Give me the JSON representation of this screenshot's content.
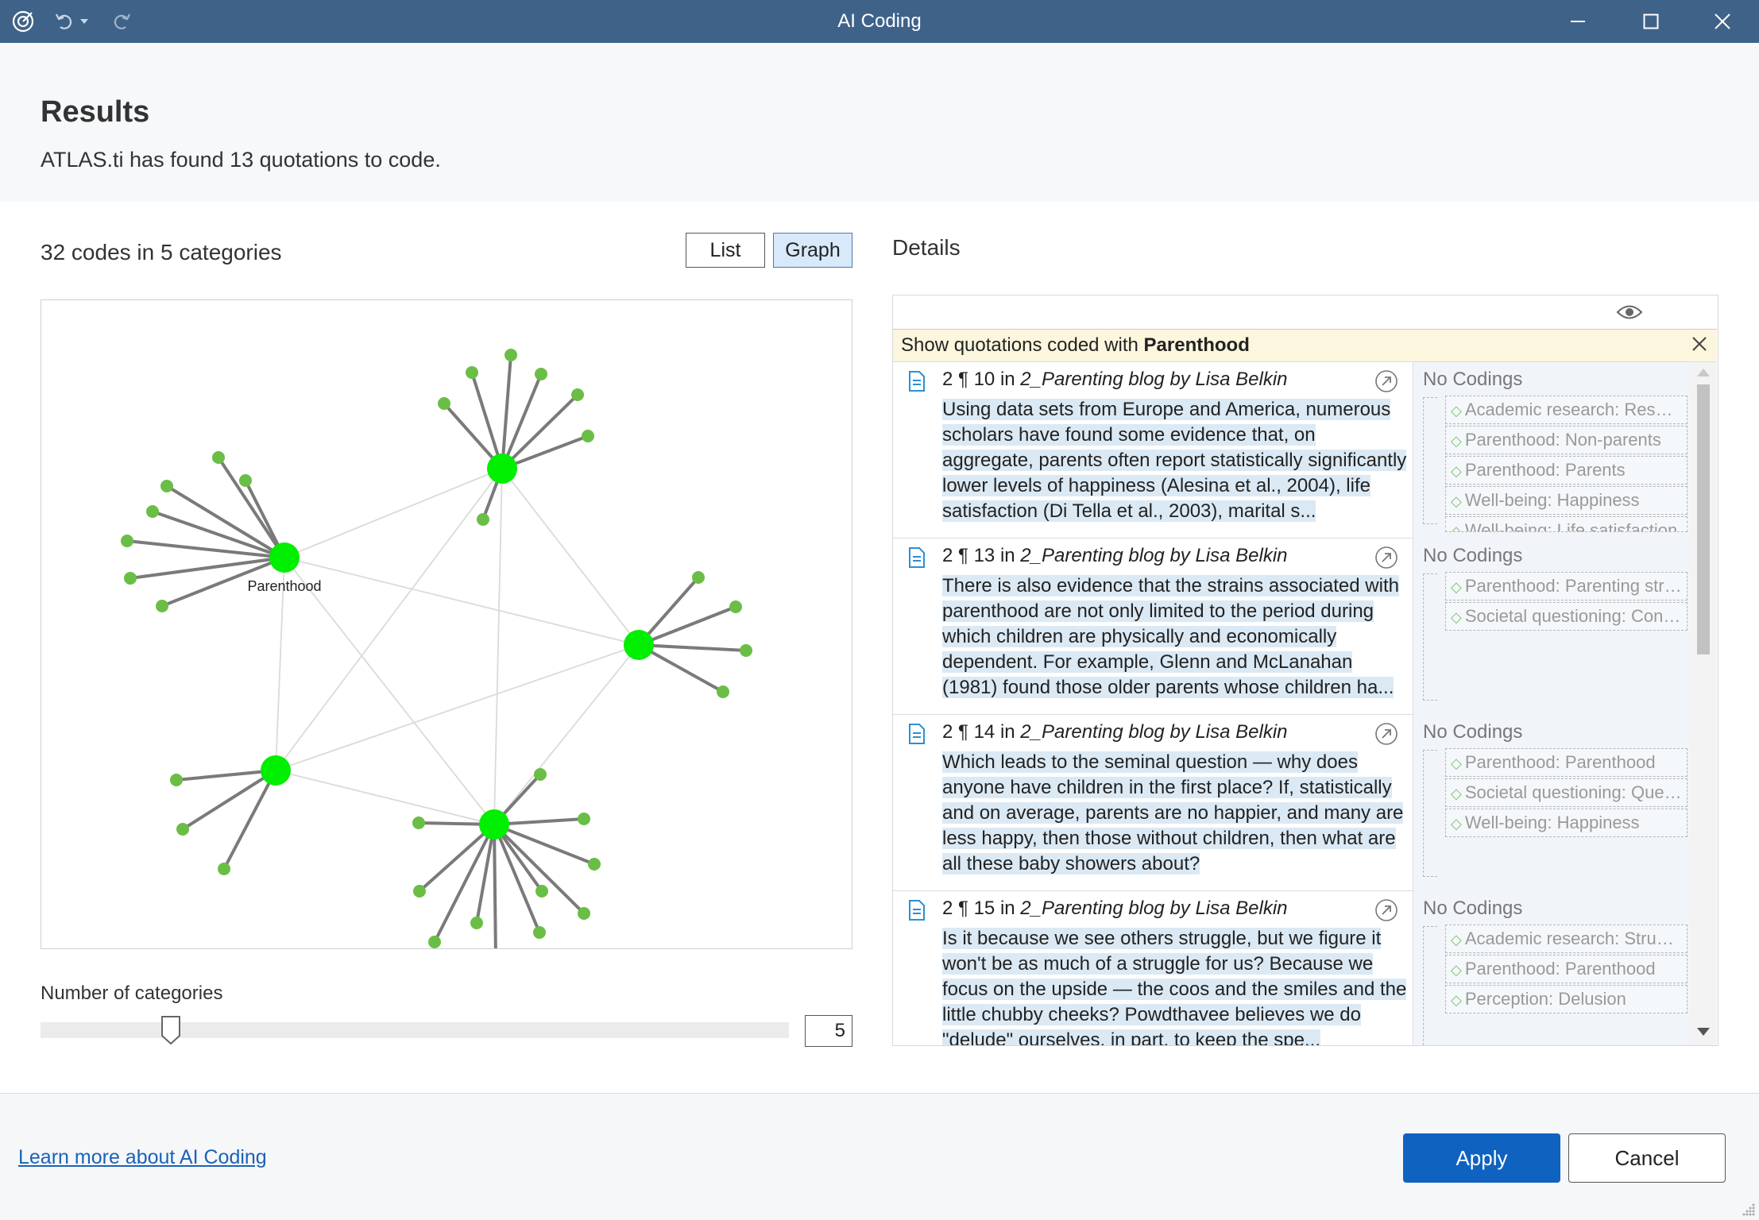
{
  "window": {
    "title": "AI Coding"
  },
  "header": {
    "title": "Results",
    "subtitle": "ATLAS.ti has found 13 quotations to code."
  },
  "left_panel": {
    "codes_summary": "32 codes in 5 categories",
    "view_toggle": {
      "list_label": "List",
      "graph_label": "Graph",
      "active": "Graph"
    },
    "graph": {
      "node_color": "#00ee00",
      "leaf_color": "#6abe45",
      "edge_color": "#7a7a7a",
      "hub_label": "Parenthood",
      "categories": 5
    },
    "slider": {
      "label": "Number of categories",
      "value": "5"
    }
  },
  "details": {
    "title": "Details",
    "filter_prefix": "Show quotations coded with ",
    "filter_code": "Parenthood",
    "quotations": [
      {
        "ref": "2 ¶ 10 in ",
        "doc": "2_Parenting blog by Lisa Belkin",
        "text": "Using data sets from Europe and America, numerous scholars have found some evidence that, on aggregate, parents often report statistically significantly lower levels of happiness (Alesina et al., 2004), life satisfaction (Di Tella et al., 2003), marital s...",
        "status": "No Codings",
        "suggested": [
          "Academic research: Resear...",
          "Parenthood: Non-parents",
          "Parenthood: Parents",
          "Well-being: Happiness",
          "Well-being: Life satisfaction"
        ]
      },
      {
        "ref": "2 ¶ 13 in ",
        "doc": "2_Parenting blog by Lisa Belkin",
        "text": "There is also evidence that the strains associated with parenthood are not only limited to the period during which children are physically and economically dependent. For example, Glenn and McLanahan (1981) found those older parents whose children ha...",
        "status": "No Codings",
        "suggested": [
          "Parenthood: Parenting stress",
          "Societal questioning: Contr..."
        ]
      },
      {
        "ref": "2 ¶ 14 in ",
        "doc": "2_Parenting blog by Lisa Belkin",
        "text": "Which leads to the seminal question — why does anyone have children in the first place? If, statistically and on average, parents are no happier, and many are less happy, then those without children, then what are all these baby showers about?",
        "status": "No Codings",
        "suggested": [
          "Parenthood: Parenthood",
          "Societal questioning: Ques...",
          "Well-being: Happiness"
        ]
      },
      {
        "ref": "2 ¶ 15 in ",
        "doc": "2_Parenting blog by Lisa Belkin",
        "text": "Is it because we see others struggle, but we figure it won't be as much of a struggle for us? Because we focus on the upside — the coos and the smiles and the little chubby cheeks? Powdthavee believes we do \"delude\" ourselves, in part, to keep the spe...",
        "status": "No Codings",
        "suggested": [
          "Academic research: Struggle",
          "Parenthood: Parenthood",
          "Perception: Delusion"
        ]
      }
    ]
  },
  "footer": {
    "learn_more": "Learn more about AI Coding",
    "apply_label": "Apply",
    "cancel_label": "Cancel"
  }
}
